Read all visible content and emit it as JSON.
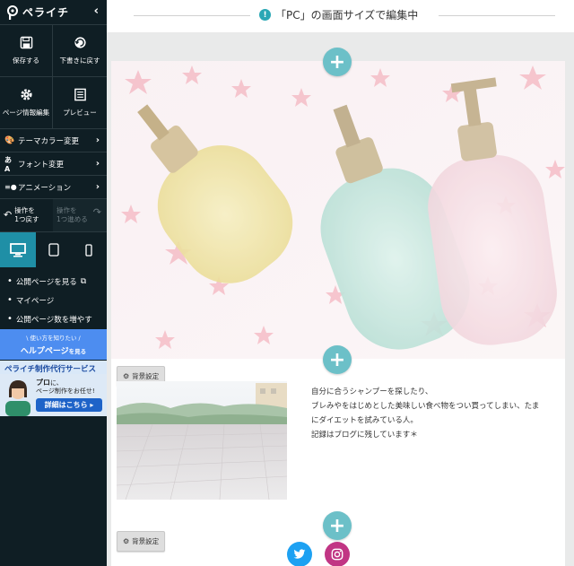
{
  "sidebar": {
    "logo": "ペライチ",
    "tiles": [
      {
        "label": "保存する",
        "icon": "save-icon"
      },
      {
        "label": "下書きに戻す",
        "icon": "revert-draft-icon"
      },
      {
        "label": "ページ情報編集",
        "icon": "gear-icon"
      },
      {
        "label": "プレビュー",
        "icon": "preview-icon"
      }
    ],
    "menu": [
      {
        "label": "テーマカラー変更",
        "icon": "palette-icon"
      },
      {
        "label": "フォント変更",
        "icon": "font-icon"
      },
      {
        "label": "アニメーション",
        "icon": "animation-icon"
      }
    ],
    "undo": {
      "line1": "操作を",
      "line2": "1つ戻す"
    },
    "redo": {
      "line1": "操作を",
      "line2": "1つ進める"
    },
    "devices": [
      "desktop",
      "tablet",
      "mobile"
    ],
    "links": [
      "公開ページを見る",
      "マイページ",
      "公開ページ数を増やす"
    ],
    "help": {
      "small": "\\ 使い方を知りたい /",
      "main": "ヘルプページ",
      "suffix": "を見る"
    },
    "ad": {
      "title": "ペライチ制作代行サービス",
      "line1_bold": "プロ",
      "line1_rest": "に、",
      "line2": "ページ制作をお任せ!",
      "cta": "詳細はこちら ▸"
    }
  },
  "topbar": {
    "notice": "「PC」の画面サイズで編集中"
  },
  "editor": {
    "bg_button_label": "背景設定",
    "text_lines": [
      "自分に合うシャンプーを探したり、",
      "ブレみやをはじめとした美味しい食べ物をつい買ってしまい、たま",
      "にダイエットを試みている人。",
      "記録はブログに残しています＊"
    ]
  },
  "colors": {
    "sidebar_bg": "#0f1e24",
    "accent": "#1f8fa6",
    "add_button": "#6cc0c8",
    "help_banner": "#4d8df0",
    "twitter": "#1da1f2"
  }
}
